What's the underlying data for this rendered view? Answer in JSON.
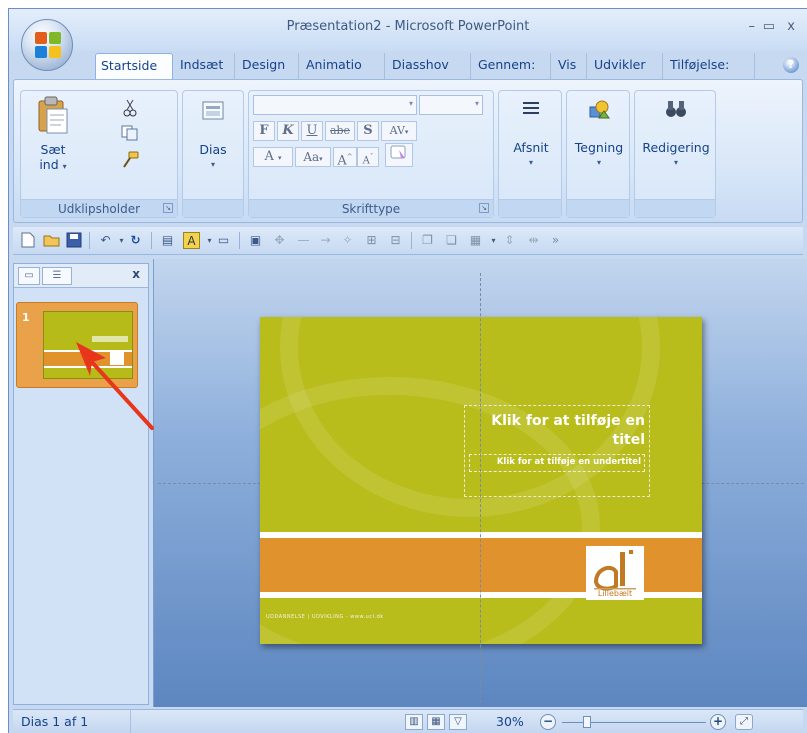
{
  "window": {
    "title": "Præsentation2 - Microsoft PowerPoint",
    "minimize_glyph": "–",
    "restore_glyph": "▭",
    "close_glyph": "x"
  },
  "tabs": [
    {
      "label": "Startside",
      "active": true
    },
    {
      "label": "Indsæt"
    },
    {
      "label": "Design"
    },
    {
      "label": "Animatio"
    },
    {
      "label": "Diasshov"
    },
    {
      "label": "Gennem:"
    },
    {
      "label": "Vis"
    },
    {
      "label": "Udvikler"
    },
    {
      "label": "Tilføjelse:"
    }
  ],
  "ribbon": {
    "clipboard": {
      "paste_label_1": "Sæt",
      "paste_label_2": "ind",
      "group_label": "Udklipsholder"
    },
    "slides": {
      "label": "Dias"
    },
    "font": {
      "group_label": "Skrifttype",
      "bold": "F",
      "italic": "K",
      "underline": "U",
      "strike": "abe",
      "shadow": "S",
      "spacing": "AV",
      "grow": "A",
      "shrink": "Aa",
      "case_big": "A",
      "case_small": "A"
    },
    "paragraph": {
      "label": "Afsnit"
    },
    "drawing": {
      "label": "Tegning"
    },
    "editing": {
      "label": "Redigering"
    }
  },
  "slide_panel": {
    "slide_number": "1",
    "close_glyph": "x"
  },
  "slide": {
    "title": "Klik for at tilføje en titel",
    "subtitle": "Klik for at tilføje en undertitel",
    "footer": "UDDANNELSE | UDVIKLING - www.ucl.dk",
    "logo_text": "Lillebælt",
    "colors": {
      "background": "#b9bd1b",
      "band": "#e0932c",
      "logo": "#c27a22"
    }
  },
  "statusbar": {
    "slide_indicator": "Dias 1 af 1",
    "zoom": "30%"
  },
  "annotation": {
    "arrow_color": "#e8361c"
  }
}
